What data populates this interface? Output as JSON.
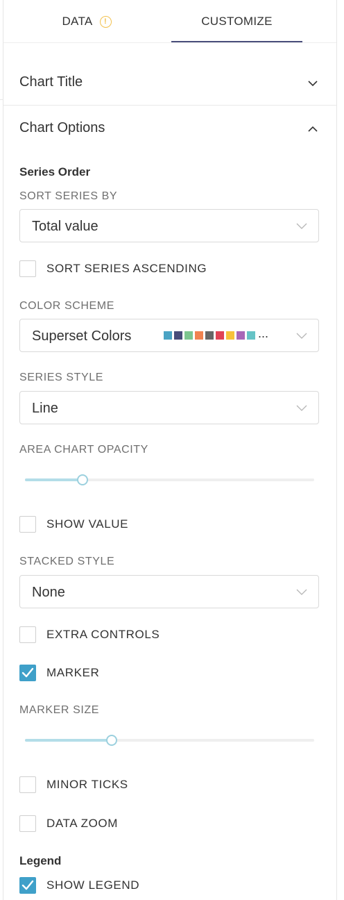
{
  "tabs": {
    "data": "DATA",
    "customize": "CUSTOMIZE"
  },
  "sections": {
    "chart_title": "Chart Title",
    "chart_options": "Chart Options"
  },
  "series_order": {
    "heading": "Series Order",
    "sort_by_label": "SORT SERIES BY",
    "sort_by_value": "Total value",
    "sort_ascending_label": "SORT SERIES ASCENDING",
    "sort_ascending_checked": false
  },
  "color_scheme": {
    "label": "COLOR SCHEME",
    "value": "Superset Colors",
    "swatches": [
      "#4aa3c4",
      "#484d7a",
      "#7cc58f",
      "#f0824f",
      "#666666",
      "#e04355",
      "#f7c23b",
      "#a868b7",
      "#66c3c6"
    ],
    "more": "..."
  },
  "series_style": {
    "label": "SERIES STYLE",
    "value": "Line"
  },
  "area_opacity": {
    "label": "AREA CHART OPACITY",
    "value": 0.2
  },
  "show_value": {
    "label": "SHOW VALUE",
    "checked": false
  },
  "stacked_style": {
    "label": "STACKED STYLE",
    "value": "None"
  },
  "extra_controls": {
    "label": "EXTRA CONTROLS",
    "checked": false
  },
  "marker": {
    "label": "MARKER",
    "checked": true
  },
  "marker_size": {
    "label": "MARKER SIZE",
    "value": 0.3
  },
  "minor_ticks": {
    "label": "MINOR TICKS",
    "checked": false
  },
  "data_zoom": {
    "label": "DATA ZOOM",
    "checked": false
  },
  "legend": {
    "heading": "Legend",
    "show_legend_label": "SHOW LEGEND",
    "show_legend_checked": true
  }
}
